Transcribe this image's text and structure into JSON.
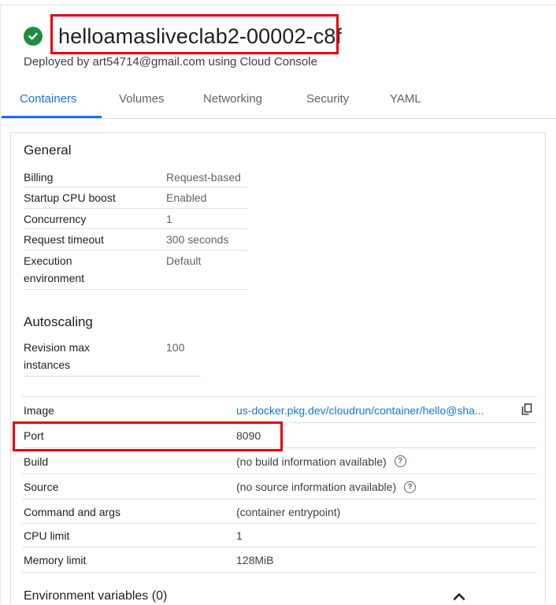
{
  "header": {
    "status_icon": "check-circle-icon",
    "revision_name": "helloamasliveclab2-00002-c8f",
    "deployed_by": "Deployed by art54714@gmail.com using Cloud Console"
  },
  "tabs": [
    {
      "label": "Containers",
      "active": true
    },
    {
      "label": "Volumes",
      "active": false
    },
    {
      "label": "Networking",
      "active": false
    },
    {
      "label": "Security",
      "active": false
    },
    {
      "label": "YAML",
      "active": false
    }
  ],
  "general": {
    "title": "General",
    "rows": [
      {
        "key": "Billing",
        "value": "Request-based"
      },
      {
        "key": "Startup CPU boost",
        "value": "Enabled"
      },
      {
        "key": "Concurrency",
        "value": "1"
      },
      {
        "key": "Request timeout",
        "value": "300 seconds"
      },
      {
        "key": "Execution environment",
        "value": "Default"
      }
    ]
  },
  "autoscaling": {
    "title": "Autoscaling",
    "rows": [
      {
        "key": "Revision max instances",
        "value": "100"
      }
    ]
  },
  "container": {
    "rows": [
      {
        "key": "Image",
        "value": "us-docker.pkg.dev/cloudrun/container/hello@sha..."
      },
      {
        "key": "Port",
        "value": "8090"
      },
      {
        "key": "Build",
        "value": "(no build information available)"
      },
      {
        "key": "Source",
        "value": "(no source information available)"
      },
      {
        "key": "Command and args",
        "value": "(container entrypoint)"
      },
      {
        "key": "CPU limit",
        "value": "1"
      },
      {
        "key": "Memory limit",
        "value": "128MiB"
      }
    ]
  },
  "env": {
    "label": "Environment variables (0)"
  },
  "colors": {
    "accent": "#1a73e8",
    "success": "#1e8e3e",
    "highlight": "#e3000f"
  }
}
